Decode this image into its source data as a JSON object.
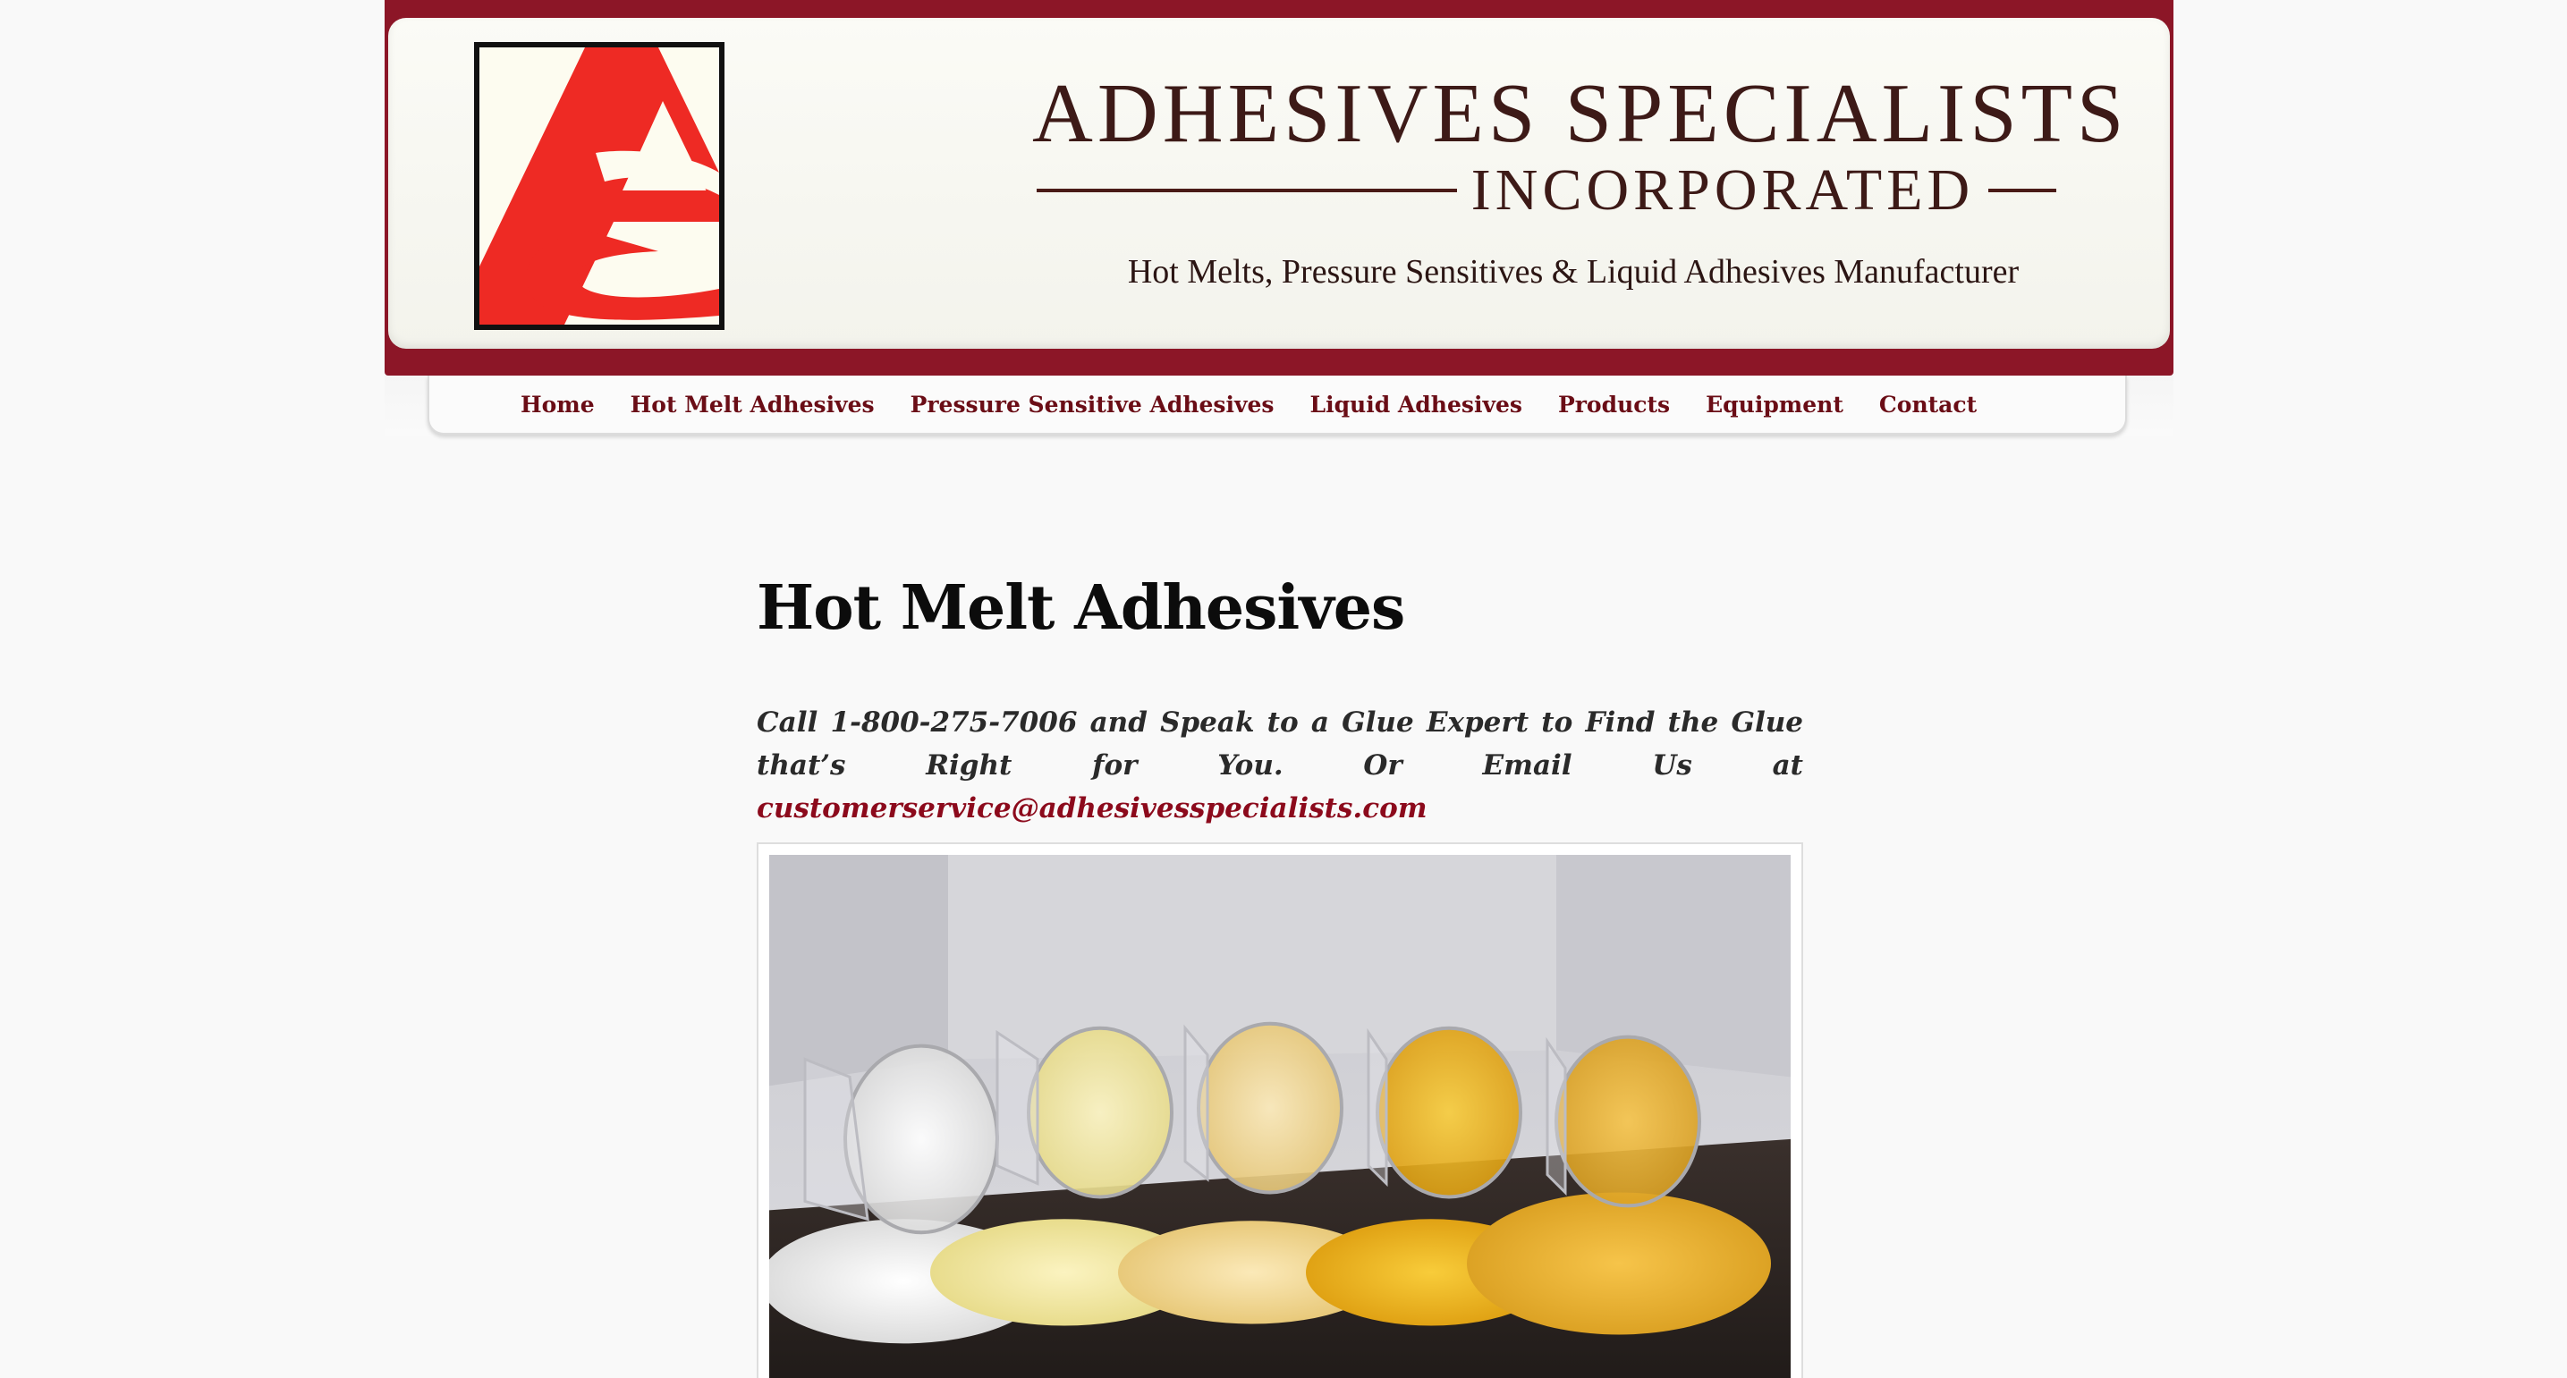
{
  "header": {
    "brand_name": "ADHESIVES SPECIALISTS",
    "brand_sub": "INCORPORATED",
    "tagline": "Hot Melts, Pressure Sensitives & Liquid Adhesives Manufacturer",
    "logo_name": "AS-logo"
  },
  "nav": {
    "items": [
      {
        "label": "Home"
      },
      {
        "label": "Hot Melt Adhesives"
      },
      {
        "label": "Pressure Sensitive Adhesives"
      },
      {
        "label": "Liquid Adhesives"
      },
      {
        "label": "Products"
      },
      {
        "label": "Equipment"
      },
      {
        "label": "Contact"
      }
    ]
  },
  "main": {
    "title": "Hot Melt Adhesives",
    "intro_text": "Call 1-800-275-7006 and Speak to a Glue Expert to Find the Glue that’s Right for You. Or Email Us at ",
    "email": "customerservice@adhesivesspecialists.com"
  },
  "colors": {
    "brand_maroon": "#8c1627",
    "nav_text": "#6a0d16",
    "link": "#8c0a1c",
    "logo_red": "#ee2a24"
  }
}
